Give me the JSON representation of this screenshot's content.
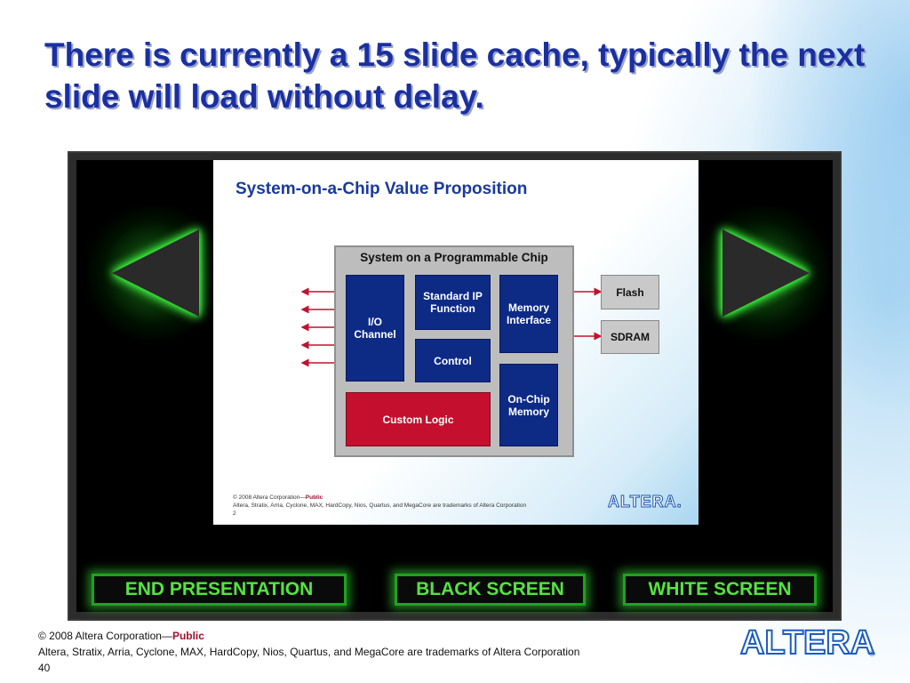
{
  "slide": {
    "title": "There is currently a 15 slide cache, typically the next slide will load without delay."
  },
  "player": {
    "prev_icon": "left-triangle-icon",
    "next_icon": "right-triangle-icon",
    "buttons": {
      "end": "END PRESENTATION",
      "black": "BLACK SCREEN",
      "white": "WHITE SCREEN"
    },
    "glow_color": "#53e53e"
  },
  "thumbnail": {
    "title": "System-on-a-Chip Value Proposition",
    "chip_title": "System on a Programmable Chip",
    "blocks": {
      "io": "I/O Channel",
      "standard_ip": "Standard IP Function",
      "memory_interface": "Memory Interface",
      "control": "Control",
      "custom_logic": "Custom Logic",
      "onchip_memory": "On-Chip Memory"
    },
    "external": {
      "flash": "Flash",
      "sdram": "SDRAM"
    },
    "footer_copyright": "© 2008 Altera Corporation—",
    "footer_public": "Public",
    "footer_trademarks": "Altera, Stratix, Arria, Cyclone, MAX, HardCopy, Nios, Quartus, and MegaCore are trademarks of Altera Corporation",
    "page_number": "2",
    "logo": "ALTERA."
  },
  "footer": {
    "copyright": "© 2008 Altera Corporation—",
    "public": "Public",
    "trademarks": "Altera, Stratix, Arria, Cyclone, MAX, HardCopy, Nios, Quartus, and MegaCore are trademarks of Altera Corporation",
    "page_number": "40",
    "logo": "ALTERA",
    "logo_mark": "®"
  },
  "colors": {
    "title": "#1a2fa0",
    "altera_blue": "#1a5cc0",
    "public_red": "#a0102e",
    "block_blue": "#0d2a85",
    "block_red": "#c4102e"
  }
}
